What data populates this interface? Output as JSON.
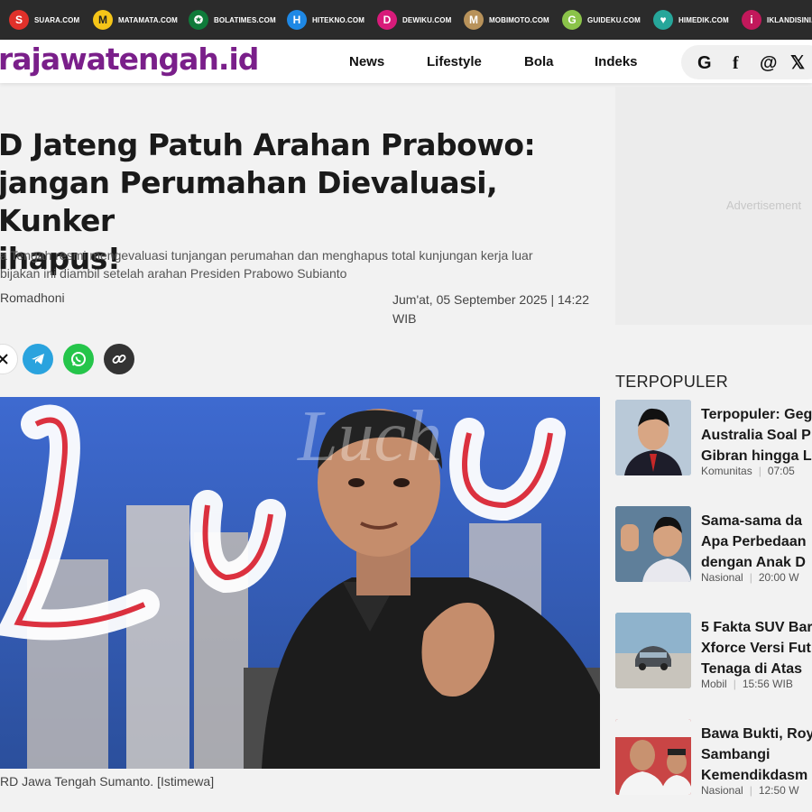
{
  "network": [
    {
      "letter": "S",
      "label": "SUARA.COM",
      "color": "#e0312a"
    },
    {
      "letter": "M",
      "label": "MATAMATA.COM",
      "color": "#f5c518"
    },
    {
      "letter": "✪",
      "label": "BOLATIMES.COM",
      "color": "#0f7a3a"
    },
    {
      "letter": "H",
      "label": "HITEKNO.COM",
      "color": "#1e88e5"
    },
    {
      "letter": "D",
      "label": "DEWIKU.COM",
      "color": "#d81b7a"
    },
    {
      "letter": "M",
      "label": "MOBIMOTO.COM",
      "color": "#b8925a"
    },
    {
      "letter": "G",
      "label": "GUIDEKU.COM",
      "color": "#8bc34a"
    },
    {
      "letter": "♥",
      "label": "HIMEDIK.COM",
      "color": "#26a69a"
    },
    {
      "letter": "i",
      "label": "IKLANDISINI.CO",
      "color": "#c2185b"
    }
  ],
  "header": {
    "brand": "rajawatengah.id",
    "nav": [
      "News",
      "Lifestyle",
      "Bola",
      "Indeks"
    ],
    "social": [
      {
        "glyph": "G",
        "icon": "google-icon"
      },
      {
        "glyph": "f",
        "icon": "facebook-icon"
      },
      {
        "glyph": "@",
        "icon": "threads-icon"
      },
      {
        "glyph": "𝕏",
        "icon": "x-icon"
      }
    ]
  },
  "article": {
    "title_lines": [
      "D Jateng Patuh Arahan Prabowo:",
      "jangan Perumahan Dievaluasi, Kunker",
      "ihapus!"
    ],
    "lead_lines": [
      "a Tengah resmi mengevaluasi tunjangan perumahan dan menghapus total kunjungan kerja luar",
      "bijakan ini diambil setelah arahan Presiden Prabowo Subianto"
    ],
    "author": "Romadhoni",
    "date_line1": "Jum'at, 05 September 2025 | 14:22",
    "date_line2": "WIB",
    "share": [
      {
        "icon": "x-share-icon",
        "color": "#ffffff"
      },
      {
        "icon": "telegram-share-icon",
        "color": "#2aa3de"
      },
      {
        "icon": "whatsapp-share-icon",
        "color": "#25c54a"
      },
      {
        "icon": "copy-link-icon",
        "color": "#333333"
      }
    ],
    "photo_sign": "Luch",
    "caption": "RD Jawa Tengah Sumanto. [Istimewa]"
  },
  "sidebar": {
    "ad_label": "Advertisement",
    "popular_heading": "TERPOPULER",
    "popular": [
      {
        "title": "Terpopuler: Geg\nAustralia Soal P\nGibran hingga L",
        "category": "Komunitas",
        "time": "07:05",
        "thumb": "#9ab2c8"
      },
      {
        "title": "Sama-sama da\nApa Perbedaan\ndengan Anak D",
        "category": "Nasional",
        "time": "20:00 W",
        "thumb": "#6d8aa3"
      },
      {
        "title": "5 Fakta SUV Bar\nXforce Versi Fut\nTenaga di Atas",
        "category": "Mobil",
        "time": "15:56 WIB",
        "thumb": "#7fa5bf"
      },
      {
        "title": "Bawa Bukti, Roy\nSambangi\nKemendikdasm",
        "category": "Nasional",
        "time": "12:50 W",
        "thumb": "#c43a3a"
      }
    ]
  }
}
